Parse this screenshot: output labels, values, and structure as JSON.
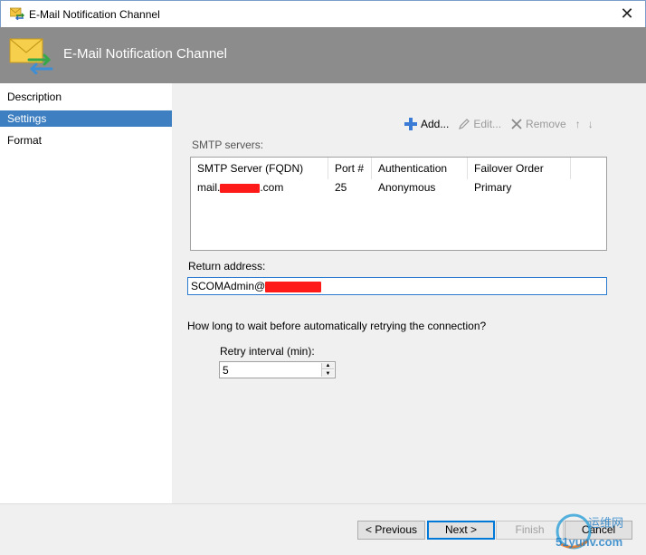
{
  "window": {
    "title": "E-Mail Notification Channel",
    "close_glyph": "✕"
  },
  "banner": {
    "heading": "E-Mail Notification Channel",
    "icon": "envelope-arrows-icon"
  },
  "nav": {
    "items": [
      {
        "label": "Description",
        "selected": false
      },
      {
        "label": "Settings",
        "selected": true
      },
      {
        "label": "Format",
        "selected": false
      }
    ]
  },
  "toolbar": {
    "add_label": "Add...",
    "edit_label": "Edit...",
    "remove_label": "Remove",
    "up_glyph": "↑",
    "down_glyph": "↓"
  },
  "smtp": {
    "label": "SMTP servers:",
    "columns": [
      "SMTP Server (FQDN)",
      "Port #",
      "Authentication",
      "Failover Order"
    ],
    "rows": [
      {
        "server_prefix": "mail.",
        "server_suffix": ".com",
        "port": "25",
        "auth": "Anonymous",
        "failover": "Primary"
      }
    ]
  },
  "return_address": {
    "label": "Return address:",
    "value_prefix": "SCOMAdmin@"
  },
  "retry": {
    "question": "How long to wait before automatically retrying the connection?",
    "label": "Retry interval (min):",
    "value": "5"
  },
  "footer": {
    "previous_label": "< Previous",
    "next_label": "Next >",
    "finish_label": "Finish",
    "cancel_label": "Cancel"
  },
  "watermark": {
    "text_top": "运维网",
    "text_bottom": "51yunv.com"
  },
  "colors": {
    "selection": "#3d7fc1",
    "banner": "#8c8c8c",
    "focus": "#0078d7",
    "redaction": "#ff1a1a"
  }
}
